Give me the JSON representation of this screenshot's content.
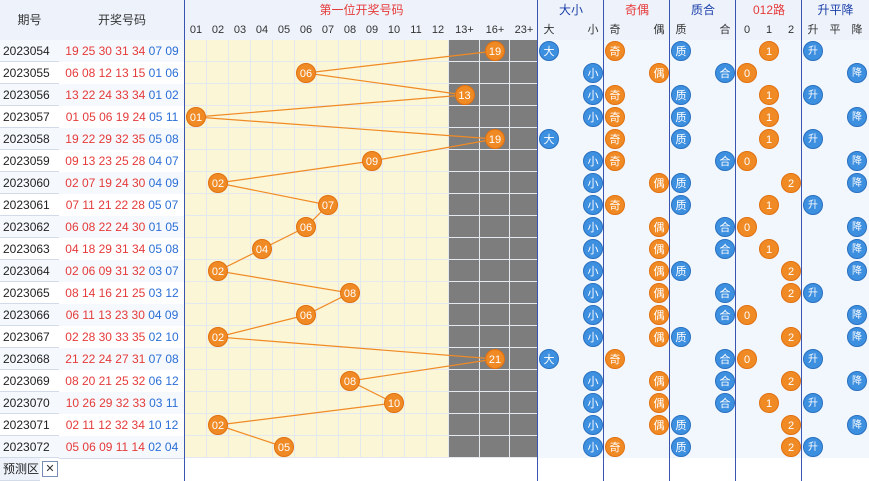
{
  "headers": {
    "period": "期号",
    "numbers": "开奖号码",
    "first_pos": "第一位开奖号码",
    "big_small": "大小",
    "odd_even": "奇偶",
    "prime_comp": "质合",
    "route012": "012路",
    "trend": "升平降",
    "cols": [
      "01",
      "02",
      "03",
      "04",
      "05",
      "06",
      "07",
      "08",
      "09",
      "10",
      "11",
      "12",
      "13+",
      "16+",
      "23+"
    ],
    "bs_cols": [
      "大",
      "",
      "小"
    ],
    "oe_cols": [
      "奇",
      "",
      "偶"
    ],
    "pc_cols": [
      "质",
      "",
      "合"
    ],
    "r_cols": [
      "0",
      "1",
      "2"
    ],
    "t_cols": [
      "升",
      "平",
      "降"
    ]
  },
  "footer": {
    "predict": "预测区",
    "close": "✕"
  },
  "rows": [
    {
      "p": "2023054",
      "red": "19 25 30 31 34",
      "blue": "07 09",
      "first": "19"
    },
    {
      "p": "2023055",
      "red": "06 08 12 13 15",
      "blue": "01 06",
      "first": "06"
    },
    {
      "p": "2023056",
      "red": "13 22 24 33 34",
      "blue": "01 02",
      "first": "13"
    },
    {
      "p": "2023057",
      "red": "01 05 06 19 24",
      "blue": "05 11",
      "first": "01"
    },
    {
      "p": "2023058",
      "red": "19 22 29 32 35",
      "blue": "05 08",
      "first": "19"
    },
    {
      "p": "2023059",
      "red": "09 13 23 25 28",
      "blue": "04 07",
      "first": "09"
    },
    {
      "p": "2023060",
      "red": "02 07 19 24 30",
      "blue": "04 09",
      "first": "02"
    },
    {
      "p": "2023061",
      "red": "07 11 21 22 28",
      "blue": "05 07",
      "first": "07"
    },
    {
      "p": "2023062",
      "red": "06 08 22 24 30",
      "blue": "01 05",
      "first": "06"
    },
    {
      "p": "2023063",
      "red": "04 18 29 31 34",
      "blue": "05 08",
      "first": "04"
    },
    {
      "p": "2023064",
      "red": "02 06 09 31 32",
      "blue": "03 07",
      "first": "02"
    },
    {
      "p": "2023065",
      "red": "08 14 16 21 25",
      "blue": "03 12",
      "first": "08"
    },
    {
      "p": "2023066",
      "red": "06 11 13 23 30",
      "blue": "04 09",
      "first": "06"
    },
    {
      "p": "2023067",
      "red": "02 28 30 33 35",
      "blue": "02 10",
      "first": "02"
    },
    {
      "p": "2023068",
      "red": "21 22 24 27 31",
      "blue": "07 08",
      "first": "21"
    },
    {
      "p": "2023069",
      "red": "08 20 21 25 32",
      "blue": "06 12",
      "first": "08"
    },
    {
      "p": "2023070",
      "red": "10 26 29 32 33",
      "blue": "03 11",
      "first": "10"
    },
    {
      "p": "2023071",
      "red": "02 11 12 32 34",
      "blue": "10 12",
      "first": "02"
    },
    {
      "p": "2023072",
      "red": "05 06 09 11 14",
      "blue": "02 04",
      "first": "05"
    }
  ],
  "colors": {
    "orange": "#f08a24",
    "blue": "#3d8fe0",
    "gray": "#9b9b9b",
    "header_red": "#e53a3a",
    "header_blue": "#1b3fa8"
  }
}
